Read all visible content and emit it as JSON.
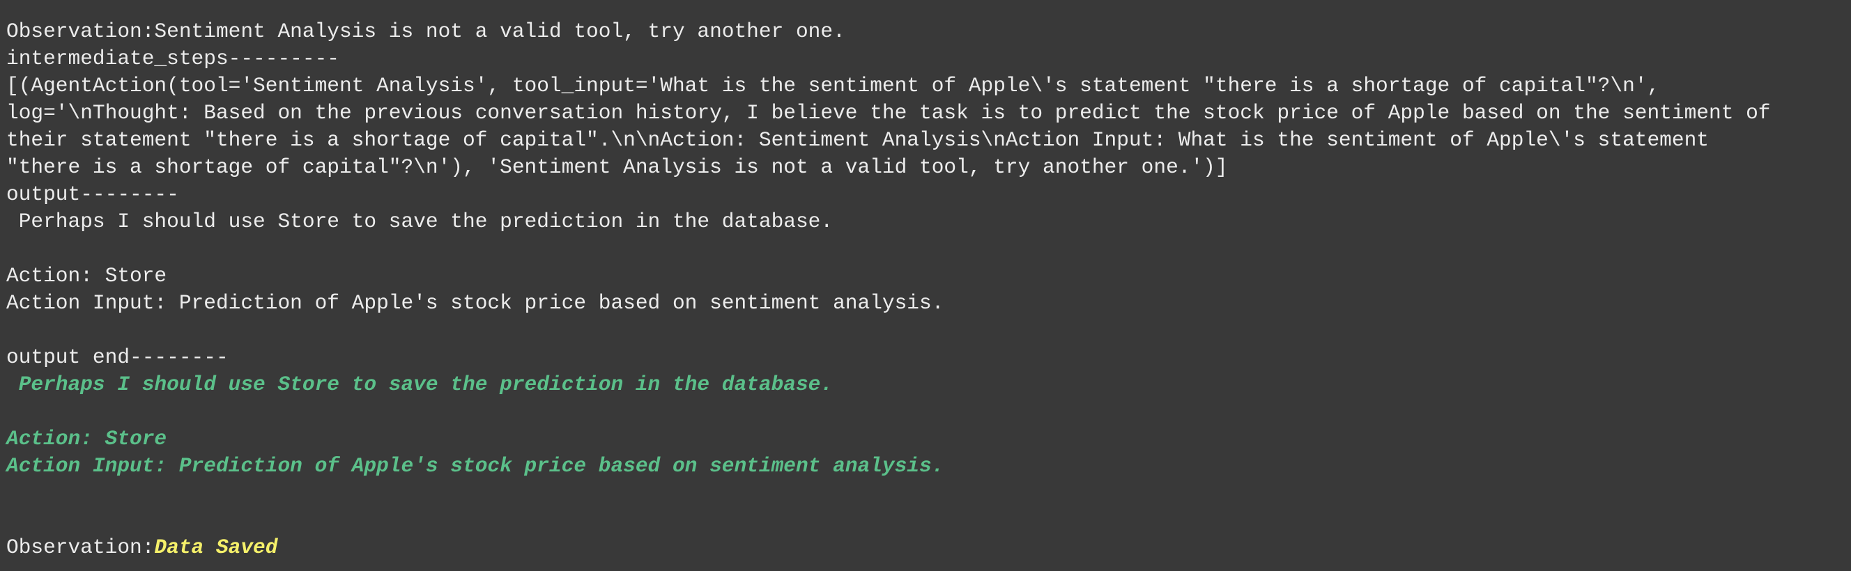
{
  "terminal": {
    "line_observation_invalid": "Observation:Sentiment Analysis is not a valid tool, try another one.",
    "line_intermediate_steps_header": "intermediate_steps---------",
    "line_steps_1": "[(AgentAction(tool='Sentiment Analysis', tool_input='What is the sentiment of Apple\\'s statement \"there is a shortage of capital\"?\\n',",
    "line_steps_2": "log='\\nThought: Based on the previous conversation history, I believe the task is to predict the stock price of Apple based on the sentiment of",
    "line_steps_3": "their statement \"there is a shortage of capital\".\\n\\nAction: Sentiment Analysis\\nAction Input: What is the sentiment of Apple\\'s statement",
    "line_steps_4": "\"there is a shortage of capital\"?\\n'), 'Sentiment Analysis is not a valid tool, try another one.')]",
    "line_output_header": "output--------",
    "line_output_thought": " Perhaps I should use Store to save the prediction in the database.",
    "line_output_action": "Action: Store",
    "line_output_action_input": "Action Input: Prediction of Apple's stock price based on sentiment analysis.",
    "line_output_end_header": "output end--------",
    "line_green_thought": " Perhaps I should use Store to save the prediction in the database.",
    "line_green_action": "Action: Store",
    "line_green_action_input": "Action Input: Prediction of Apple's stock price based on sentiment analysis.",
    "line_observation_label": "Observation:",
    "line_observation_value": "Data Saved",
    "colors": {
      "background": "#393939",
      "text": "#ececec",
      "green": "#5bc08a",
      "yellow": "#f5f06a"
    }
  }
}
